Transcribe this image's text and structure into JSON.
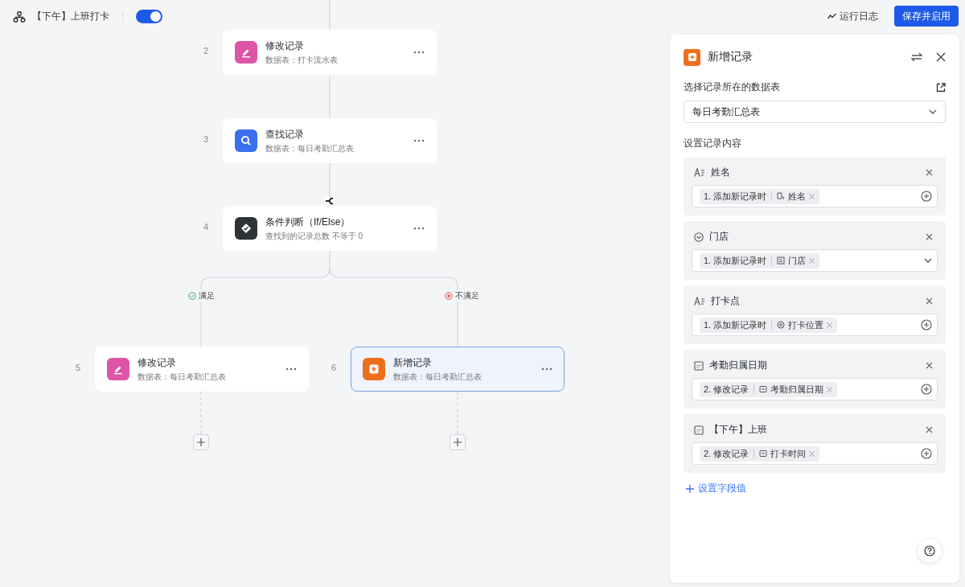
{
  "workflow": {
    "title": "【下午】上班打卡",
    "enabled": true
  },
  "toolbar": {
    "log_link": "运行日志",
    "save_button": "保存并启用"
  },
  "nodes": [
    {
      "index": "2",
      "kind": "edit",
      "title": "修改记录",
      "subtitle": "数据表：打卡流水表",
      "selected": false
    },
    {
      "index": "3",
      "kind": "search",
      "title": "查找记录",
      "subtitle": "数据表：每日考勤汇总表",
      "selected": false
    },
    {
      "index": "4",
      "kind": "condition",
      "title": "条件判断（If/Else）",
      "subtitle": "查找到的记录总数 不等于 0",
      "selected": false
    },
    {
      "index": "5",
      "kind": "edit",
      "title": "修改记录",
      "subtitle": "数据表：每日考勤汇总表",
      "selected": false
    },
    {
      "index": "6",
      "kind": "add",
      "title": "新增记录",
      "subtitle": "数据表：每日考勤汇总表",
      "selected": true
    }
  ],
  "branches": [
    {
      "kind": "yes",
      "label": "满足"
    },
    {
      "kind": "no",
      "label": "不满足"
    }
  ],
  "panel": {
    "title": "新增记录",
    "table_label": "选择记录所在的数据表",
    "table_value": "每日考勤汇总表",
    "content_label": "设置记录内容",
    "fields": [
      {
        "kind": "text",
        "name": "姓名",
        "source": "1. 添加新记录时",
        "token": {
          "kind": "text",
          "label": "姓名"
        }
      },
      {
        "kind": "select",
        "name": "门店",
        "source": "1. 添加新记录时",
        "token": {
          "kind": "select",
          "label": "门店"
        }
      },
      {
        "kind": "text",
        "name": "打卡点",
        "source": "1. 添加新记录时",
        "token": {
          "kind": "location",
          "label": "打卡位置"
        }
      },
      {
        "kind": "date",
        "name": "考勤归属日期",
        "source": "2. 修改记录",
        "token": {
          "kind": "date",
          "label": "考勤归属日期"
        }
      },
      {
        "kind": "date",
        "name": "【下午】上班",
        "source": "2. 修改记录",
        "token": {
          "kind": "date",
          "label": "打卡时间"
        }
      }
    ],
    "add_field": "设置字段值"
  }
}
